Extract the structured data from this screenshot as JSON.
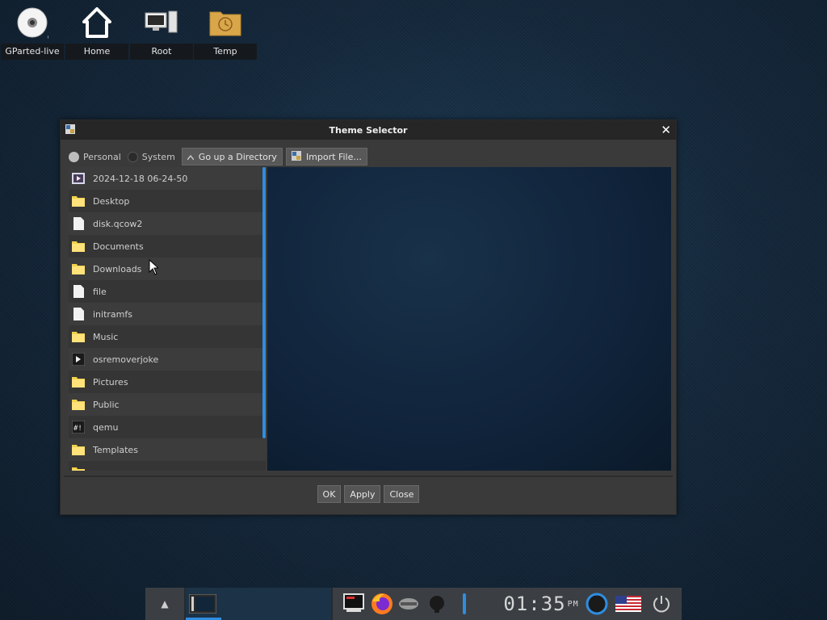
{
  "desktop": {
    "icons": [
      {
        "label": "GParted-live",
        "icon": "disc-icon"
      },
      {
        "label": "Home",
        "icon": "home-icon"
      },
      {
        "label": "Root",
        "icon": "computer-icon"
      },
      {
        "label": "Temp",
        "icon": "folder-clock-icon"
      }
    ]
  },
  "window": {
    "title": "Theme Selector",
    "close_glyph": "✕",
    "toolbar": {
      "personal_label": "Personal",
      "system_label": "System",
      "go_up_label": "Go up a Directory",
      "import_label": "Import File..."
    },
    "files": [
      {
        "name": "2024-12-18 06-24-50",
        "type": "video"
      },
      {
        "name": "Desktop",
        "type": "folder"
      },
      {
        "name": "disk.qcow2",
        "type": "file"
      },
      {
        "name": "Documents",
        "type": "folder"
      },
      {
        "name": "Downloads",
        "type": "folder"
      },
      {
        "name": "file",
        "type": "file"
      },
      {
        "name": "initramfs",
        "type": "file"
      },
      {
        "name": "Music",
        "type": "folder"
      },
      {
        "name": "osremoverjoke",
        "type": "executable"
      },
      {
        "name": "Pictures",
        "type": "folder"
      },
      {
        "name": "Public",
        "type": "folder"
      },
      {
        "name": "qemu",
        "type": "script"
      },
      {
        "name": "Templates",
        "type": "folder"
      }
    ],
    "buttons": {
      "ok": "OK",
      "apply": "Apply",
      "close": "Close"
    }
  },
  "taskbar": {
    "up_glyph": "▲",
    "clock": {
      "hour": "01",
      "minute": "35",
      "ampm": "PM"
    }
  },
  "colors": {
    "accent": "#2f8de0",
    "folder": "#f2d24c"
  }
}
